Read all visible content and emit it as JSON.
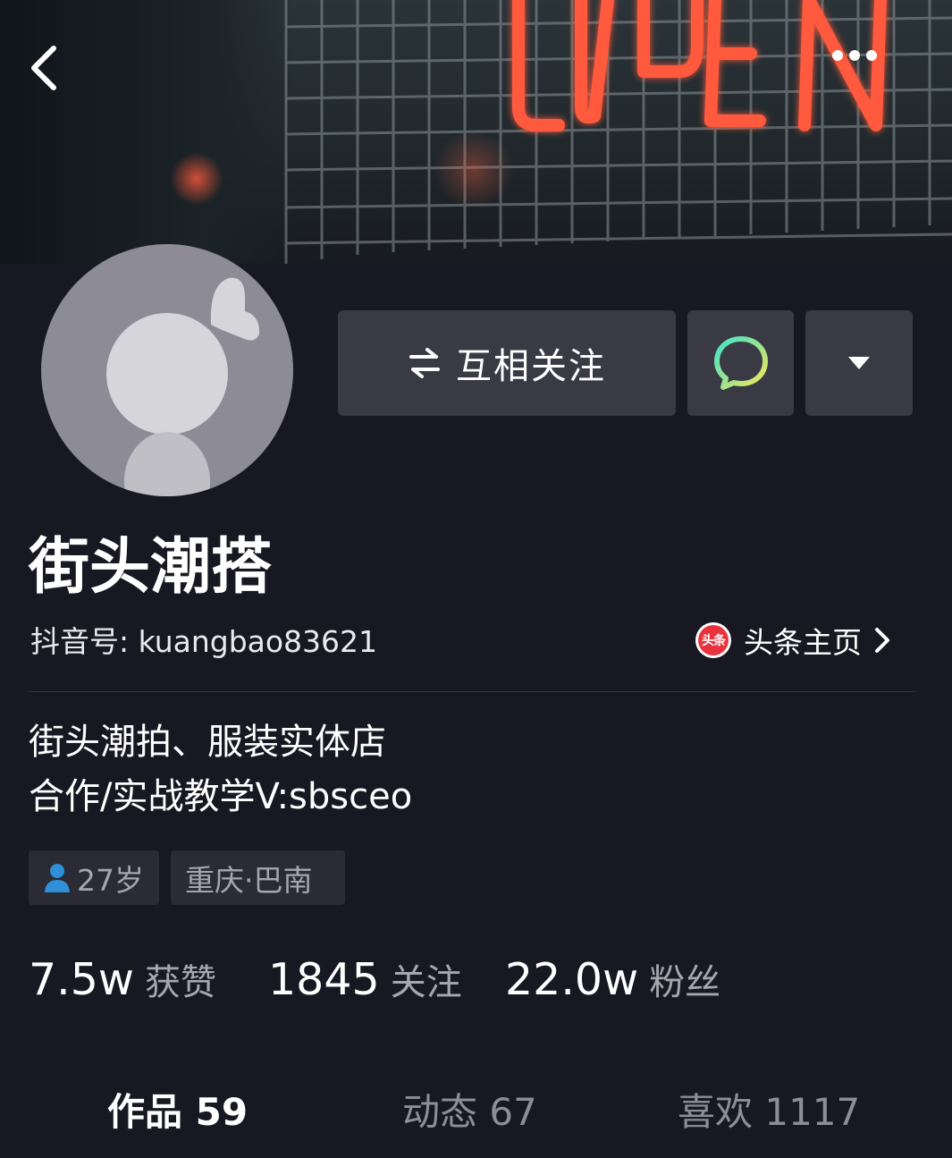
{
  "header": {
    "banner_sign_text": "OPEN",
    "back_icon": "chevron-left-icon",
    "more_icon": "more-dots-icon"
  },
  "actions": {
    "follow_label": "互相关注",
    "follow_icon": "swap-arrows-icon",
    "message_icon": "chat-bubble-icon",
    "dropdown_icon": "caret-down-icon"
  },
  "profile": {
    "name": "街头潮搭",
    "douyin_id": "抖音号: kuangbao83621",
    "toutiao_badge_text": "头条",
    "toutiao_label": "头条主页",
    "bio_lines": [
      "街头潮拍、服装实体店",
      "合作/实战教学V:sbsceo"
    ],
    "age": "27岁",
    "location": "重庆·巴南"
  },
  "stats": [
    {
      "value": "7.5w",
      "label": "获赞"
    },
    {
      "value": "1845",
      "label": "关注"
    },
    {
      "value": "22.0w",
      "label": "粉丝"
    }
  ],
  "tabs": [
    {
      "label": "作品 59",
      "active": true
    },
    {
      "label": "动态 67",
      "active": false
    },
    {
      "label": "喜欢 1117",
      "active": false
    }
  ],
  "colors": {
    "background": "#171821",
    "button_bg": "#393a44",
    "tag_bg": "#2a2b35",
    "muted_text": "#a5a6ae",
    "neon": "#ff5a3c",
    "chat_gradient_start": "#3fe3c6",
    "chat_gradient_end": "#f5e65a",
    "toutiao_red": "#e8333f"
  }
}
